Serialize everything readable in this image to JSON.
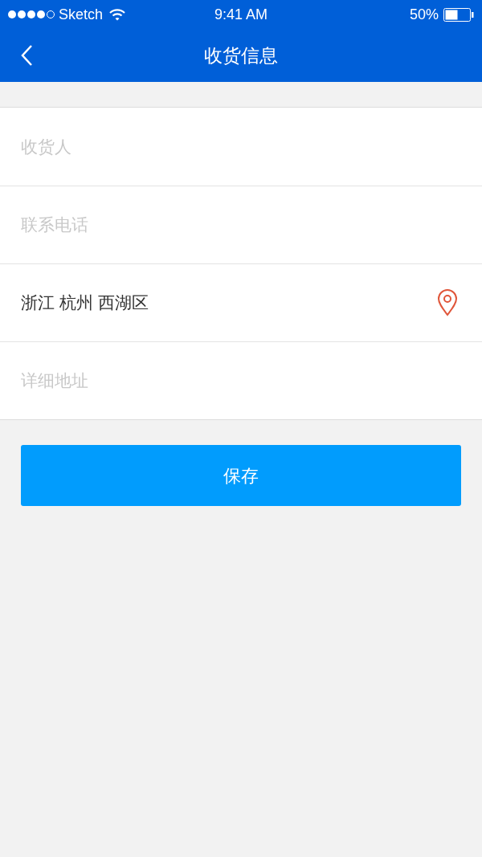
{
  "status_bar": {
    "carrier": "Sketch",
    "time": "9:41 AM",
    "battery": "50%"
  },
  "nav": {
    "title": "收货信息"
  },
  "fields": [
    {
      "kind": "input",
      "placeholder": "收货人"
    },
    {
      "kind": "input",
      "placeholder": "联系电话"
    },
    {
      "kind": "location",
      "value": "浙江 杭州 西湖区"
    },
    {
      "kind": "input",
      "placeholder": "详细地址"
    }
  ],
  "save_button": "保存"
}
